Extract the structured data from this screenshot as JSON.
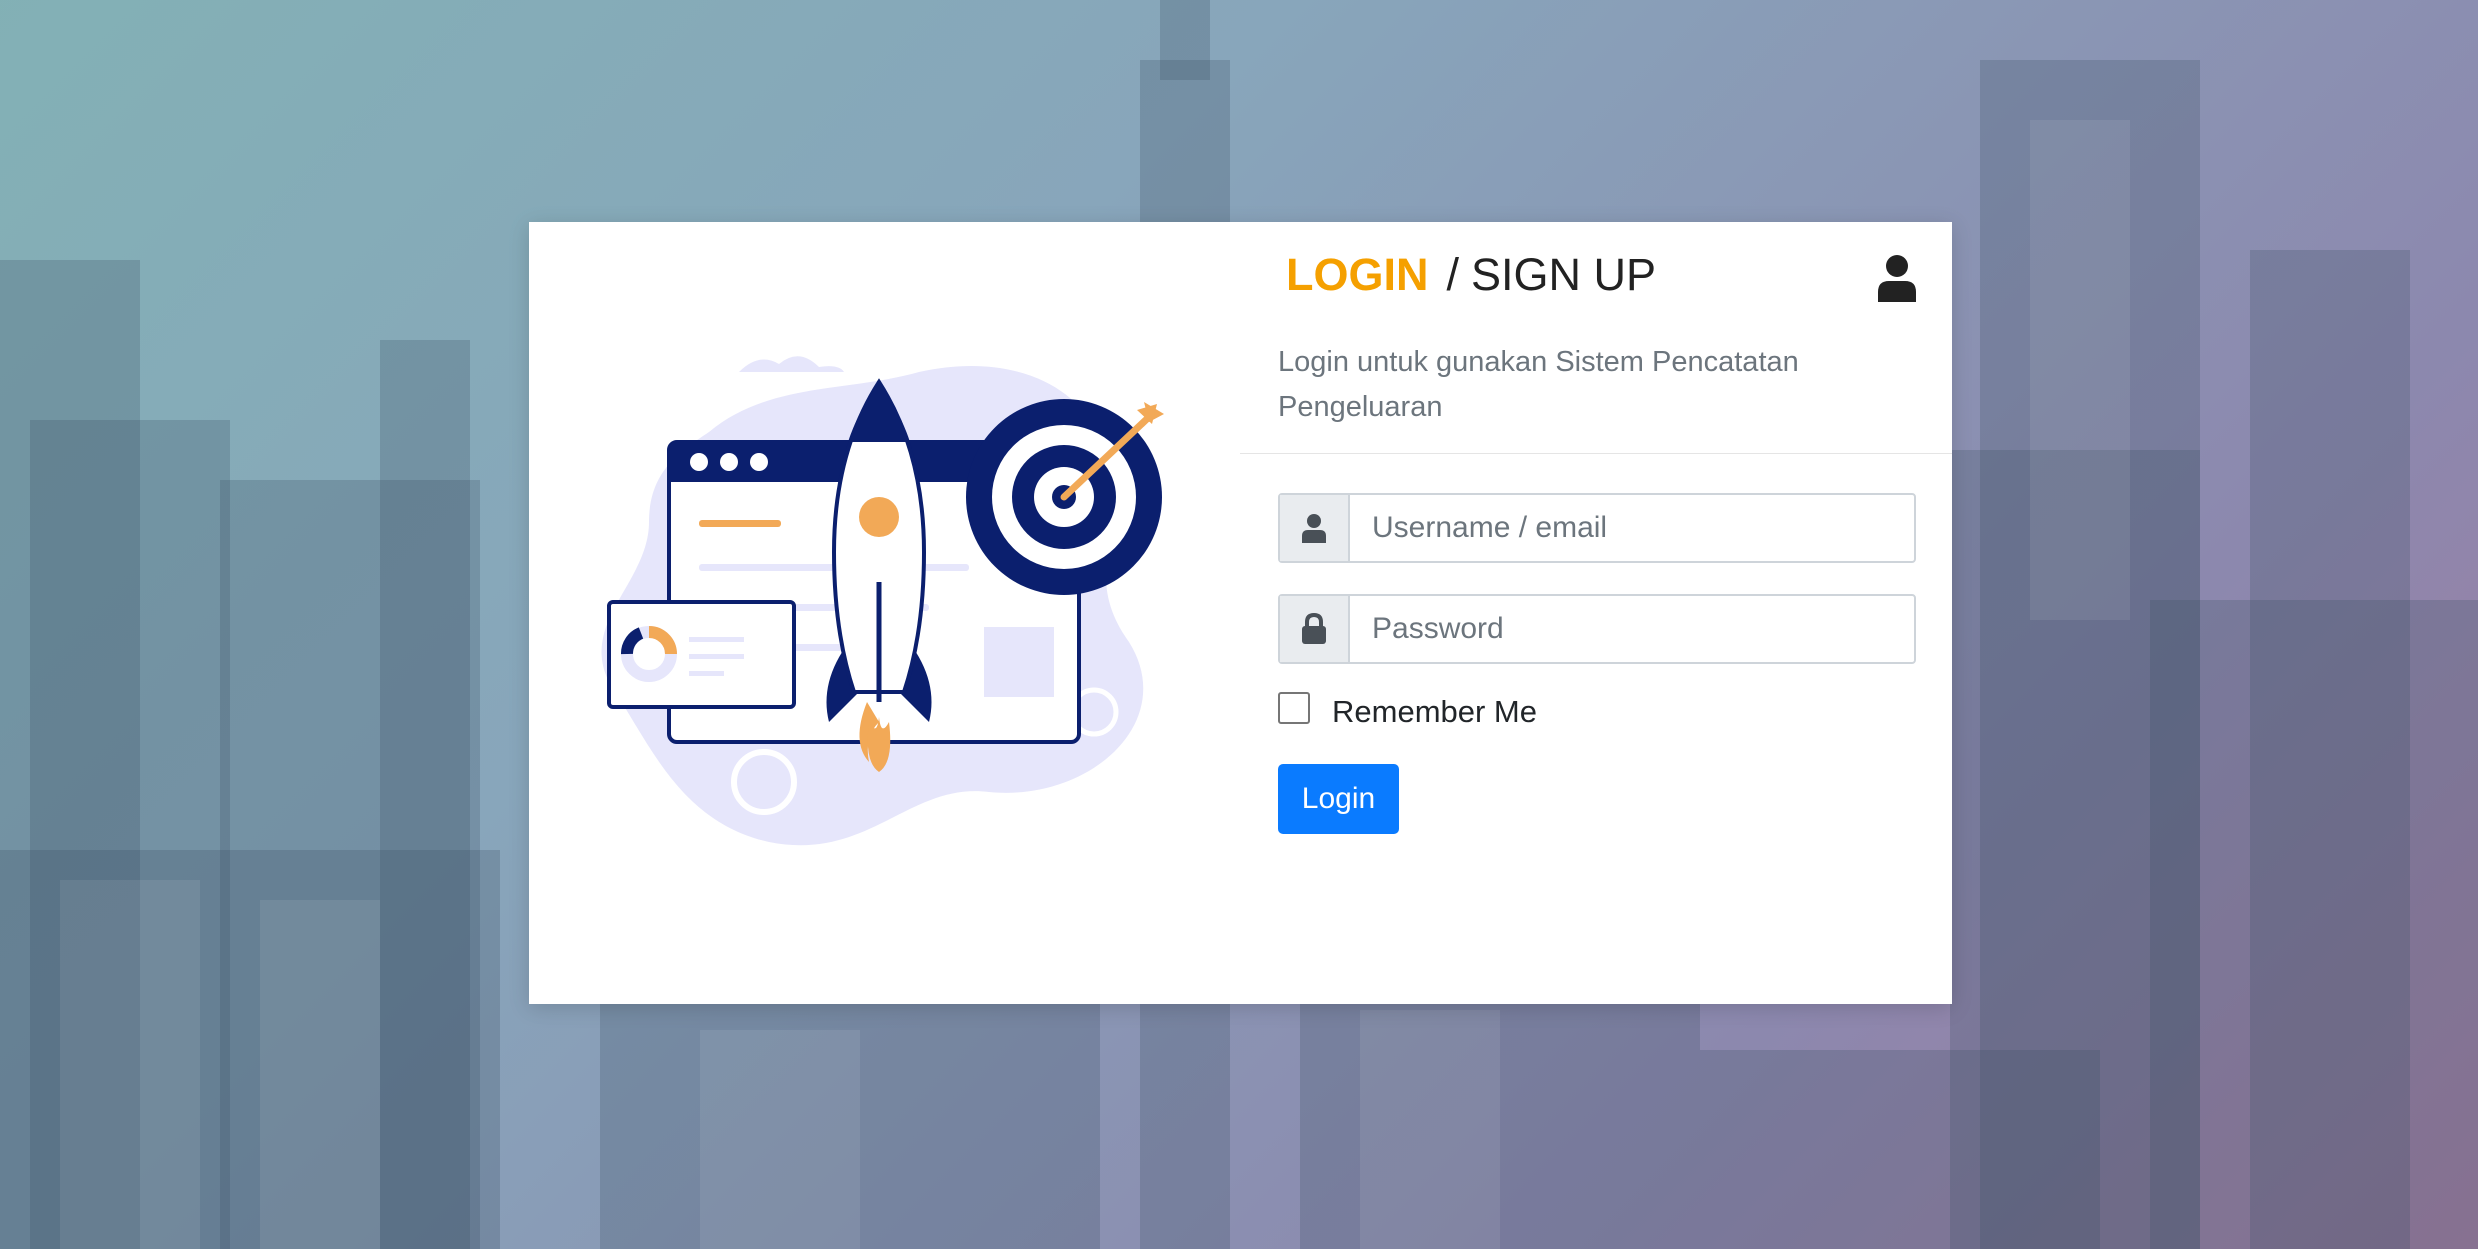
{
  "header": {
    "login_label": "LOGIN",
    "separator": "/",
    "signup_label": "SIGN UP"
  },
  "subtitle": "Login untuk gunakan Sistem Pencatatan Pengeluaran",
  "form": {
    "username_placeholder": "Username / email",
    "username_value": "",
    "password_placeholder": "Password",
    "password_value": "",
    "remember_label": "Remember Me",
    "remember_checked": false,
    "submit_label": "Login"
  },
  "icons": {
    "account": "user-icon",
    "username": "user-icon",
    "password": "lock-icon"
  },
  "colors": {
    "accent": "#f5a000",
    "primary": "#0a7bff",
    "illustration_navy": "#0b1f6e",
    "illustration_orange": "#f2a957",
    "illustration_lavender": "#e6e6fb"
  }
}
